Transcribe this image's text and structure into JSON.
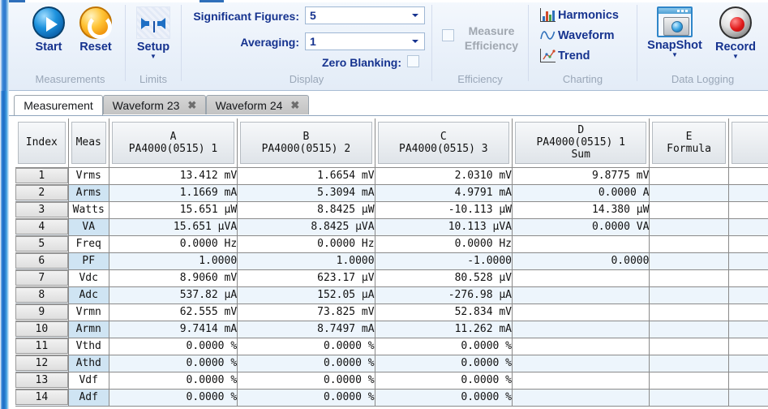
{
  "ribbon": {
    "groups": [
      {
        "name": "measurements",
        "title": "Measurements"
      },
      {
        "name": "limits",
        "title": "Limits"
      },
      {
        "name": "display",
        "title": "Display"
      },
      {
        "name": "efficiency",
        "title": "Efficiency"
      },
      {
        "name": "charting",
        "title": "Charting"
      },
      {
        "name": "data-logging",
        "title": "Data Logging"
      }
    ],
    "measurements": {
      "start_label": "Start",
      "reset_label": "Reset"
    },
    "limits": {
      "setup_label": "Setup"
    },
    "display": {
      "sig_figs_label": "Significant Figures:",
      "sig_figs_value": "5",
      "averaging_label": "Averaging:",
      "averaging_value": "1",
      "zero_blanking_label": "Zero Blanking:",
      "zero_blanking_checked": false
    },
    "efficiency": {
      "measure_efficiency_label": "Measure\nEfficiency",
      "measure_efficiency_line1": "Measure",
      "measure_efficiency_line2": "Efficiency",
      "checked": false,
      "disabled": true
    },
    "charting": {
      "harmonics_label": "Harmonics",
      "waveform_label": "Waveform",
      "trend_label": "Trend"
    },
    "data_logging": {
      "snapshot_label": "SnapShot",
      "record_label": "Record"
    }
  },
  "tabs": [
    {
      "label": "Measurement",
      "active": true,
      "closable": false
    },
    {
      "label": "Waveform 23",
      "active": false,
      "closable": true,
      "close_glyph": "✖"
    },
    {
      "label": "Waveform 24",
      "active": false,
      "closable": true,
      "close_glyph": "✖"
    }
  ],
  "grid": {
    "columns": [
      {
        "key": "index",
        "top": "Index",
        "sub": ""
      },
      {
        "key": "meas",
        "top": "Meas",
        "sub": ""
      },
      {
        "key": "A",
        "top": "A",
        "sub": "PA4000(0515) 1"
      },
      {
        "key": "B",
        "top": "B",
        "sub": "PA4000(0515) 2"
      },
      {
        "key": "C",
        "top": "C",
        "sub": "PA4000(0515) 3"
      },
      {
        "key": "D",
        "top": "D",
        "sub": "PA4000(0515) 1",
        "sub2": "Sum"
      },
      {
        "key": "E",
        "top": "E",
        "sub": "Formula"
      },
      {
        "key": "F",
        "top": "",
        "sub": ""
      }
    ],
    "rows": [
      {
        "index": "1",
        "meas": "Vrms",
        "A": "13.412 mV",
        "B": "1.6654 mV",
        "C": "2.0310 mV",
        "D": "9.8775 mV",
        "E": "",
        "F": ""
      },
      {
        "index": "2",
        "meas": "Arms",
        "A": "1.1669 mA",
        "B": "5.3094 mA",
        "C": "4.9791 mA",
        "D": "0.0000 A",
        "E": "",
        "F": ""
      },
      {
        "index": "3",
        "meas": "Watts",
        "A": "15.651 µW",
        "B": "8.8425 µW",
        "C": "-10.113 µW",
        "D": "14.380 µW",
        "E": "",
        "F": ""
      },
      {
        "index": "4",
        "meas": "VA",
        "A": "15.651 µVA",
        "B": "8.8425 µVA",
        "C": "10.113 µVA",
        "D": "0.0000 VA",
        "E": "",
        "F": ""
      },
      {
        "index": "5",
        "meas": "Freq",
        "A": "0.0000 Hz",
        "B": "0.0000 Hz",
        "C": "0.0000 Hz",
        "D": "",
        "E": "",
        "F": ""
      },
      {
        "index": "6",
        "meas": "PF",
        "A": "1.0000",
        "B": "1.0000",
        "C": "-1.0000",
        "D": "0.0000",
        "E": "",
        "F": ""
      },
      {
        "index": "7",
        "meas": "Vdc",
        "A": "8.9060 mV",
        "B": "623.17 µV",
        "C": "80.528 µV",
        "D": "",
        "E": "",
        "F": ""
      },
      {
        "index": "8",
        "meas": "Adc",
        "A": "537.82 µA",
        "B": "152.05 µA",
        "C": "-276.98 µA",
        "D": "",
        "E": "",
        "F": ""
      },
      {
        "index": "9",
        "meas": "Vrmn",
        "A": "62.555 mV",
        "B": "73.825 mV",
        "C": "52.834 mV",
        "D": "",
        "E": "",
        "F": ""
      },
      {
        "index": "10",
        "meas": "Armn",
        "A": "9.7414 mA",
        "B": "8.7497 mA",
        "C": "11.262 mA",
        "D": "",
        "E": "",
        "F": ""
      },
      {
        "index": "11",
        "meas": "Vthd",
        "A": "0.0000 %",
        "B": "0.0000 %",
        "C": "0.0000 %",
        "D": "",
        "E": "",
        "F": ""
      },
      {
        "index": "12",
        "meas": "Athd",
        "A": "0.0000 %",
        "B": "0.0000 %",
        "C": "0.0000 %",
        "D": "",
        "E": "",
        "F": ""
      },
      {
        "index": "13",
        "meas": "Vdf",
        "A": "0.0000 %",
        "B": "0.0000 %",
        "C": "0.0000 %",
        "D": "",
        "E": "",
        "F": ""
      },
      {
        "index": "14",
        "meas": "Adf",
        "A": "0.0000 %",
        "B": "0.0000 %",
        "C": "0.0000 %",
        "D": "",
        "E": "",
        "F": ""
      }
    ]
  },
  "colors": {
    "accent_blue": "#16338f",
    "group_title_gray": "#9aa7b8",
    "meas_cell_blue": "#d4e8f5",
    "alt_row_blue": "#edf5fc"
  }
}
